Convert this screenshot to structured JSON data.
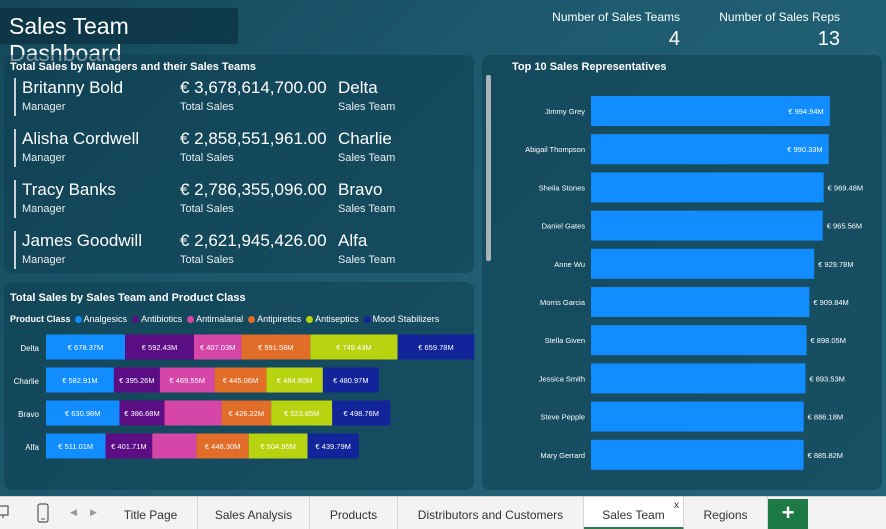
{
  "header": {
    "title": "Sales Team Dashboard",
    "kpis": [
      {
        "label": "Number of Sales Teams",
        "value": "4"
      },
      {
        "label": "Number of Sales Reps",
        "value": "13"
      }
    ]
  },
  "managers_card": {
    "title": "Total Sales by Managers and their Sales Teams",
    "manager_label": "Manager",
    "sales_label": "Total Sales",
    "team_label": "Sales Team",
    "rows": [
      {
        "name": "Britanny Bold",
        "sales": "€ 3,678,614,700.00",
        "team": "Delta"
      },
      {
        "name": "Alisha Cordwell",
        "sales": "€ 2,858,551,961.00",
        "team": "Charlie"
      },
      {
        "name": "Tracy Banks",
        "sales": "€ 2,786,355,096.00",
        "team": "Bravo"
      },
      {
        "name": "James Goodwill",
        "sales": "€ 2,621,945,426.00",
        "team": "Alfa"
      }
    ]
  },
  "colors": {
    "Analgesics": "#118dff",
    "Antibiotics": "#5b0d84",
    "Antimalarial": "#d645a8",
    "Antipiretics": "#e16d28",
    "Antiseptics": "#b8d30f",
    "Mood Stabilizers": "#12249a",
    "rep_bar": "#118dff"
  },
  "stacked_card": {
    "title": "Total Sales by Sales Team and Product Class",
    "legend_title": "Product Class"
  },
  "reps_card": {
    "title": "Top 10 Sales Representatives"
  },
  "chart_data": [
    {
      "type": "bar",
      "orientation": "horizontal",
      "stacked": true,
      "title": "Total Sales by Sales Team and Product Class",
      "legend_title": "Product Class",
      "legend_position": "top-left",
      "categories": [
        "Delta",
        "Charlie",
        "Bravo",
        "Alfa"
      ],
      "series": [
        {
          "name": "Analgesics",
          "values": [
            678.37,
            582.91,
            630.98,
            511.01
          ],
          "labels": [
            "€ 678.37M",
            "€ 582.91M",
            "€ 630.98M",
            "€ 511.01M"
          ]
        },
        {
          "name": "Antibiotics",
          "values": [
            592.43,
            395.26,
            386.68,
            401.71
          ],
          "labels": [
            "€ 592.43M",
            "€ 395.26M",
            "€ 386.68M",
            "€ 401.71M"
          ]
        },
        {
          "name": "Antimalarial",
          "values": [
            407.03,
            469.55,
            490,
            380
          ],
          "labels": [
            "€ 407.03M",
            "€ 469.55M",
            "",
            ""
          ]
        },
        {
          "name": "Antipiretics",
          "values": [
            591.58,
            445.06,
            426.22,
            448.3
          ],
          "labels": [
            "€ 591.58M",
            "€ 445.06M",
            "€ 426.22M",
            "€ 448.30M"
          ]
        },
        {
          "name": "Antiseptics",
          "values": [
            749.43,
            484.8,
            523.85,
            504.95
          ],
          "labels": [
            "€ 749.43M",
            "€ 484.80M",
            "€ 523.85M",
            "€ 504.95M"
          ]
        },
        {
          "name": "Mood Stabilizers",
          "values": [
            659.78,
            480.97,
            498.76,
            439.79
          ],
          "labels": [
            "€ 659.78M",
            "€ 480.97M",
            "€ 498.76M",
            "€ 439.79M"
          ]
        }
      ],
      "unit": "€ M",
      "xlim": [
        0,
        3950
      ],
      "grid": false
    },
    {
      "type": "bar",
      "orientation": "horizontal",
      "title": "Top 10 Sales Representatives",
      "categories": [
        "Jimmy Grey",
        "Abigail Thompson",
        "Sheila Stones",
        "Daniel Gates",
        "Anne Wu",
        "Morris Garcia",
        "Stella Given",
        "Jessica Smith",
        "Steve Pepple",
        "Mary Gerrard"
      ],
      "values": [
        994.94,
        990.33,
        969.48,
        965.56,
        929.78,
        909.84,
        898.05,
        893.53,
        886.18,
        885.82
      ],
      "labels": [
        "€ 994.94M",
        "€ 990.33M",
        "€ 969.48M",
        "€ 965.56M",
        "€ 929.78M",
        "€ 909.84M",
        "€ 898.05M",
        "€ 893.53M",
        "€ 886.18M",
        "€ 885.82M"
      ],
      "unit": "€ M",
      "xlim": [
        0,
        1000
      ],
      "grid": false
    }
  ],
  "tabs": {
    "items": [
      {
        "label": "Title Page"
      },
      {
        "label": "Sales Analysis"
      },
      {
        "label": "Products"
      },
      {
        "label": "Distributors and Customers"
      },
      {
        "label": "Sales Team",
        "active": true
      },
      {
        "label": "Regions"
      }
    ],
    "close_glyph": "x",
    "add_glyph": "+"
  }
}
